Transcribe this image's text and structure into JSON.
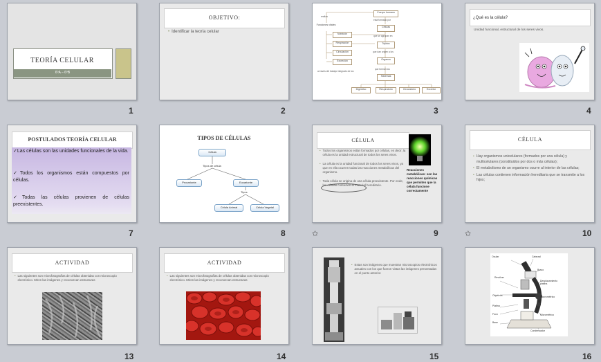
{
  "slides": [
    {
      "number": "1",
      "title": "TEORÍA CELULAR",
      "subtitle": "6ºA – 6ºB"
    },
    {
      "number": "2",
      "title": "OBJETIVO:",
      "bullets": [
        "Identificar la teoría celular"
      ]
    },
    {
      "number": "3",
      "flow": {
        "top": "Cuerpo humano",
        "l1": "está formado por",
        "cells": "Células",
        "l2": "que se agrupan en",
        "tissues": "Tejidos",
        "l3": "que dan origen a los",
        "organs": "Órganos",
        "l4": "que forman los",
        "systems": "Sistemas",
        "vital": "Funciones vitales",
        "realiza": "realiza",
        "functions": [
          "Nutrición",
          "Respiración",
          "Circulación",
          "Excreción"
        ],
        "bottomNote": "a través del trabajo integrado de los",
        "systemList": [
          "Digestivo",
          "Respiratorio",
          "Circulatorio",
          "Excretor"
        ]
      }
    },
    {
      "number": "4",
      "title": "¿Qué es la célula?",
      "text": "Unidad funcional, estructural de los seres vivos."
    },
    {
      "number": "7",
      "title": "POSTULADOS  TEORÍA  CELULAR",
      "bullets": [
        "Las células son las unidades funcionales de la vida.",
        "Todos los organismos están compuestos por células.",
        "Todas las células provienen de células preexistentes."
      ]
    },
    {
      "number": "8",
      "title": "TIPOS DE CÉLULAS",
      "diagram": {
        "root": "Célula",
        "rootLabel": "Tipos de célula",
        "prok": "Procarionte",
        "euk": "Eucarionte",
        "eukLabel": "Tipos",
        "animal": "Célula Animal",
        "plant": "Célula Vegetal"
      }
    },
    {
      "number": "9",
      "title": "CÉLULA",
      "bullets": [
        "Todos los organismos están formados por células, es decir, la célula es la unidad estructural de todos los seres vivos.",
        "La célula es la unidad funcional de todos los seres vivos, ya que en ella ocurren todas las reacciones metabólicas del organismo.",
        "Toda célula se origina de una célula preexistente. Por ende, las células contienen el material hereditario."
      ],
      "side": "Reacciones metabólicas: son las reacciones químicas que permiten que la célula funcione correctamente"
    },
    {
      "number": "10",
      "title": "CÉLULA",
      "bullets": [
        "Hay organismos unicelulares (formados por una célula) y multicelulares (constituidos por dos o más células);",
        "El metabolismo de un organismo ocurre al interior de las células;",
        "Las células contienen información hereditaria que se transmite a los hijos;"
      ]
    },
    {
      "number": "13",
      "title": "ACTIVIDAD",
      "text": "Las siguientes son microfotografías de células obtenidas con microscopio electrónico. Miren las imágenes y reconozcan estructuras"
    },
    {
      "number": "14",
      "title": "ACTIVIDAD",
      "text": "Las siguientes son microfotografías de células obtenidas con microscopio electrónico. Miren las imágenes y reconozcan estructuras"
    },
    {
      "number": "15",
      "text": "Estas son imágenes que muestran microscopios electrónicos actuales con los que fueron vistas las imágenes presentadas en el punto anterior."
    },
    {
      "number": "16",
      "labels": [
        "Ocular",
        "Cabezal",
        "Brazo",
        "Revólver",
        "Desplazamiento platina",
        "Objetivos",
        "Macrométrico",
        "Platina",
        "Foco",
        "Micrométrico",
        "Base",
        "Condensador"
      ]
    }
  ],
  "transition_icon": "star-icon",
  "colors": {
    "background": "#c9ccd3",
    "slide": "#eaeaea",
    "accent": "#8e9a6d",
    "purple": "#c6b3e3"
  }
}
